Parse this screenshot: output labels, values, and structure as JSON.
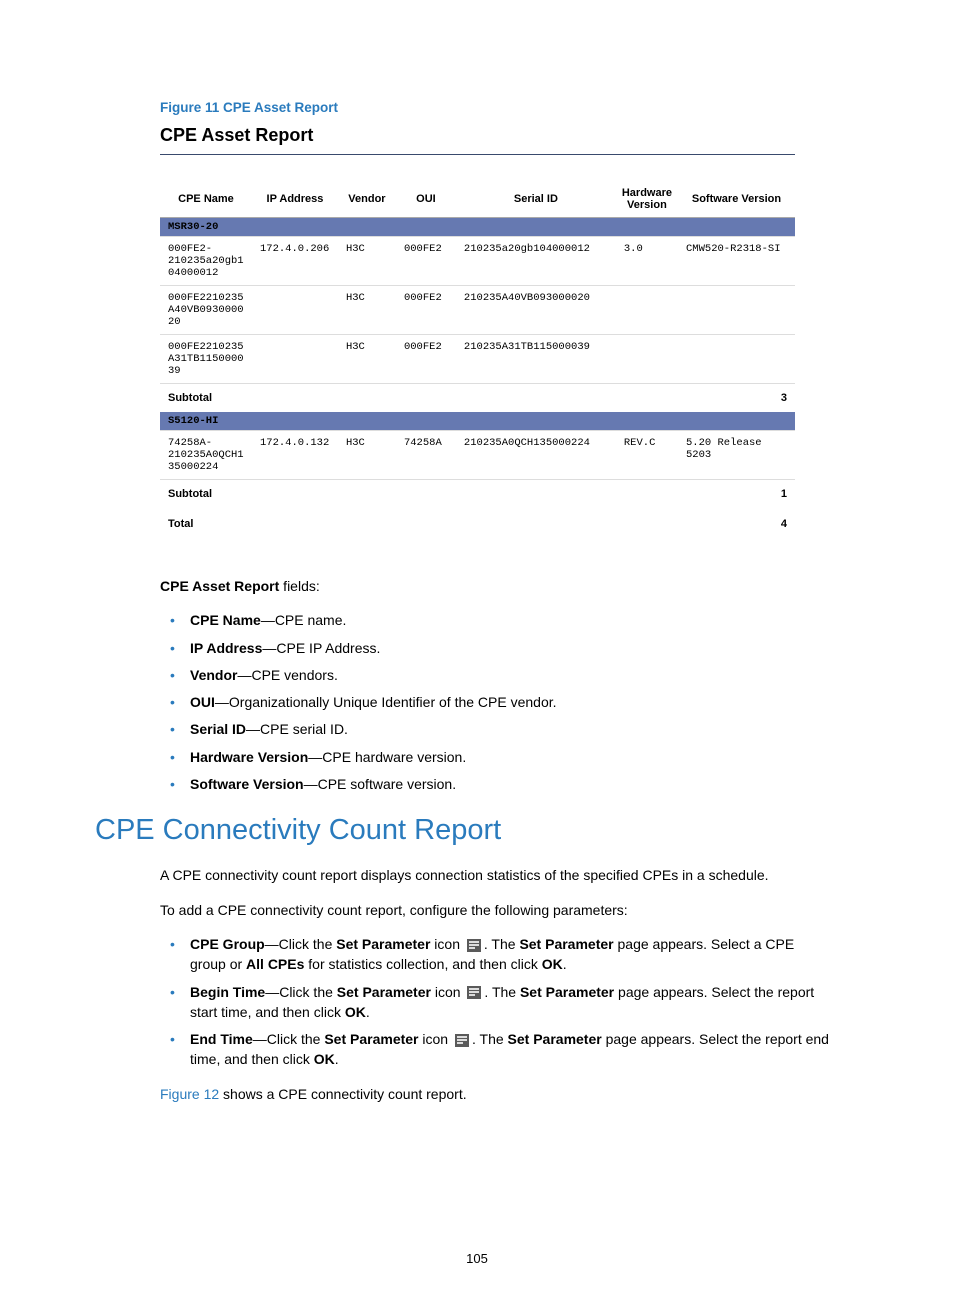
{
  "figure_caption": "Figure 11 CPE Asset Report",
  "report_title": "CPE Asset Report",
  "table": {
    "headers": [
      "CPE Name",
      "IP Address",
      "Vendor",
      "OUI",
      "Serial ID",
      "Hardware Version",
      "Software Version"
    ],
    "groups": [
      {
        "label": "MSR30-20",
        "rows": [
          {
            "cpe": "000FE2-210235a20gb104000012",
            "ip": "172.4.0.206",
            "vendor": "H3C",
            "oui": "000FE2",
            "serial": "210235a20gb104000012",
            "hw": "3.0",
            "sw": "CMW520-R2318-SI"
          },
          {
            "cpe": "000FE2210235A40VB093000020",
            "ip": "",
            "vendor": "H3C",
            "oui": "000FE2",
            "serial": "210235A40VB093000020",
            "hw": "",
            "sw": ""
          },
          {
            "cpe": "000FE2210235A31TB115000039",
            "ip": "",
            "vendor": "H3C",
            "oui": "000FE2",
            "serial": "210235A31TB115000039",
            "hw": "",
            "sw": ""
          }
        ],
        "subtotal_label": "Subtotal",
        "subtotal": "3"
      },
      {
        "label": "S5120-HI",
        "rows": [
          {
            "cpe": "74258A-210235A0QCH135000224",
            "ip": "172.4.0.132",
            "vendor": "H3C",
            "oui": "74258A",
            "serial": "210235A0QCH135000224",
            "hw": "REV.C",
            "sw": "5.20 Release 5203"
          }
        ],
        "subtotal_label": "Subtotal",
        "subtotal": "1"
      }
    ],
    "total_label": "Total",
    "total": "4"
  },
  "fields_intro": {
    "bold": "CPE Asset Report",
    "rest": " fields:"
  },
  "field_items": [
    {
      "bold": "CPE Name",
      "desc": "—CPE name."
    },
    {
      "bold": "IP Address",
      "desc": "—CPE IP Address."
    },
    {
      "bold": "Vendor",
      "desc": "—CPE vendors."
    },
    {
      "bold": "OUI",
      "desc": "—Organizationally Unique Identifier of the CPE vendor."
    },
    {
      "bold": "Serial ID",
      "desc": "—CPE serial ID."
    },
    {
      "bold": "Hardware Version",
      "desc": "—CPE hardware version."
    },
    {
      "bold": "Software Version",
      "desc": "—CPE software version."
    }
  ],
  "section_heading": "CPE Connectivity Count Report",
  "para1": "A CPE connectivity count report displays connection statistics of the specified CPEs in a schedule.",
  "para2": "To add a CPE connectivity count report, configure the following parameters:",
  "param_items": [
    {
      "bold": "CPE Group",
      "p1": "—Click the ",
      "b1": "Set Parameter",
      "p2": " icon ",
      "icon": true,
      "p3": ". The ",
      "b2": "Set Parameter",
      "p4": " page appears. Select a CPE group or ",
      "b3": "All CPEs",
      "p5": " for statistics collection, and then click ",
      "b4": "OK",
      "p6": "."
    },
    {
      "bold": "Begin Time",
      "p1": "—Click the ",
      "b1": "Set Parameter",
      "p2": " icon ",
      "icon": true,
      "p3": ". The ",
      "b2": "Set Parameter",
      "p4": " page appears. Select the report start time, and then click ",
      "b3": "OK",
      "p5": ".",
      "b4": "",
      "p6": ""
    },
    {
      "bold": "End Time",
      "p1": "—Click the ",
      "b1": "Set Parameter",
      "p2": " icon ",
      "icon": true,
      "p3": ". The ",
      "b2": "Set Parameter",
      "p4": " page appears. Select the report end time, and then click ",
      "b3": "OK",
      "p5": ".",
      "b4": "",
      "p6": ""
    }
  ],
  "closing": {
    "link": "Figure 12",
    "rest": " shows a CPE connectivity count report."
  },
  "page_number": "105"
}
